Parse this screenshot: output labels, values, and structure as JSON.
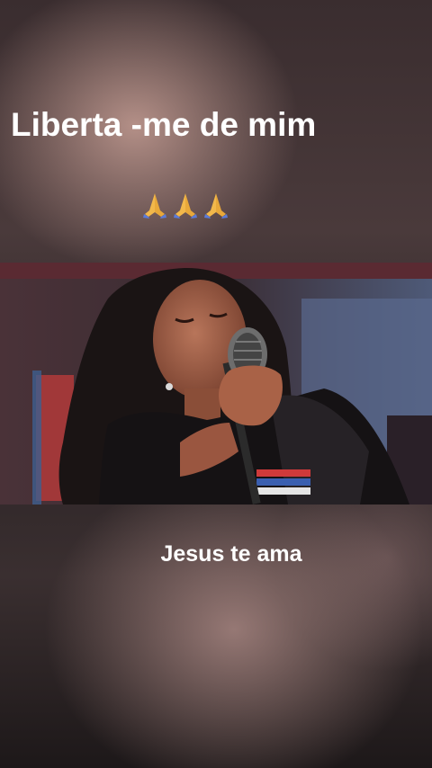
{
  "post": {
    "title": "Liberta -me de mim",
    "emojis": [
      "praying-hands",
      "praying-hands",
      "praying-hands"
    ],
    "caption": "Jesus te ama"
  },
  "colors": {
    "text": "#ffffff",
    "emoji_skin": "#f2b84b",
    "emoji_sleeve": "#5b7bd8"
  },
  "video": {
    "subject": "singer-with-microphone"
  }
}
